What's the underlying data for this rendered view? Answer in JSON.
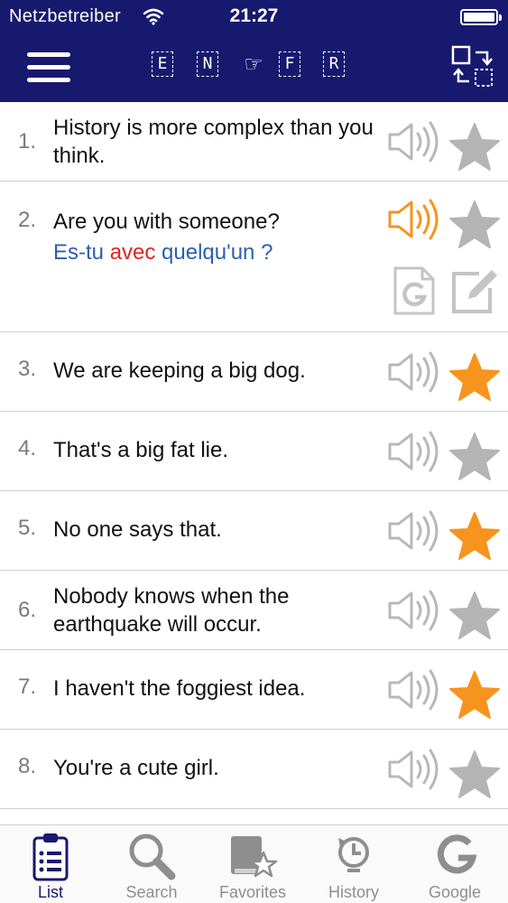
{
  "status_bar": {
    "carrier": "Netzbetreiber",
    "time": "21:27"
  },
  "nav": {
    "languages": [
      "E",
      "N",
      "F",
      "R"
    ],
    "swap_symbol": "☞"
  },
  "colors": {
    "header_bg": "#17196e",
    "star_active": "#f7941d",
    "star_inactive": "#b4b4b4",
    "speaker_active": "#f7941d",
    "translation_text": "#2a5fb0",
    "translation_highlight": "#e0261e"
  },
  "sentences": [
    {
      "num": "1.",
      "text": "History is more complex than you think.",
      "favorite": false
    },
    {
      "num": "2.",
      "text": "Are you with someone?",
      "favorite": false,
      "speaking": true,
      "translation": {
        "before": "Es-tu ",
        "highlight": "avec",
        "after": " quelqu'un ?"
      }
    },
    {
      "num": "3.",
      "text": "We are keeping a big dog.",
      "favorite": true
    },
    {
      "num": "4.",
      "text": "That's a big fat lie.",
      "favorite": false
    },
    {
      "num": "5.",
      "text": "No one says that.",
      "favorite": true
    },
    {
      "num": "6.",
      "text": "Nobody knows when the earthquake will occur.",
      "favorite": false
    },
    {
      "num": "7.",
      "text": "I haven't the foggiest idea.",
      "favorite": true
    },
    {
      "num": "8.",
      "text": "You're a cute girl.",
      "favorite": false
    }
  ],
  "tabs": [
    {
      "label": "List",
      "icon": "clipboard-list-icon",
      "active": true
    },
    {
      "label": "Search",
      "icon": "magnifier-icon",
      "active": false
    },
    {
      "label": "Favorites",
      "icon": "book-star-icon",
      "active": false
    },
    {
      "label": "History",
      "icon": "clock-history-icon",
      "active": false
    },
    {
      "label": "Google",
      "icon": "google-g-icon",
      "active": false
    }
  ]
}
